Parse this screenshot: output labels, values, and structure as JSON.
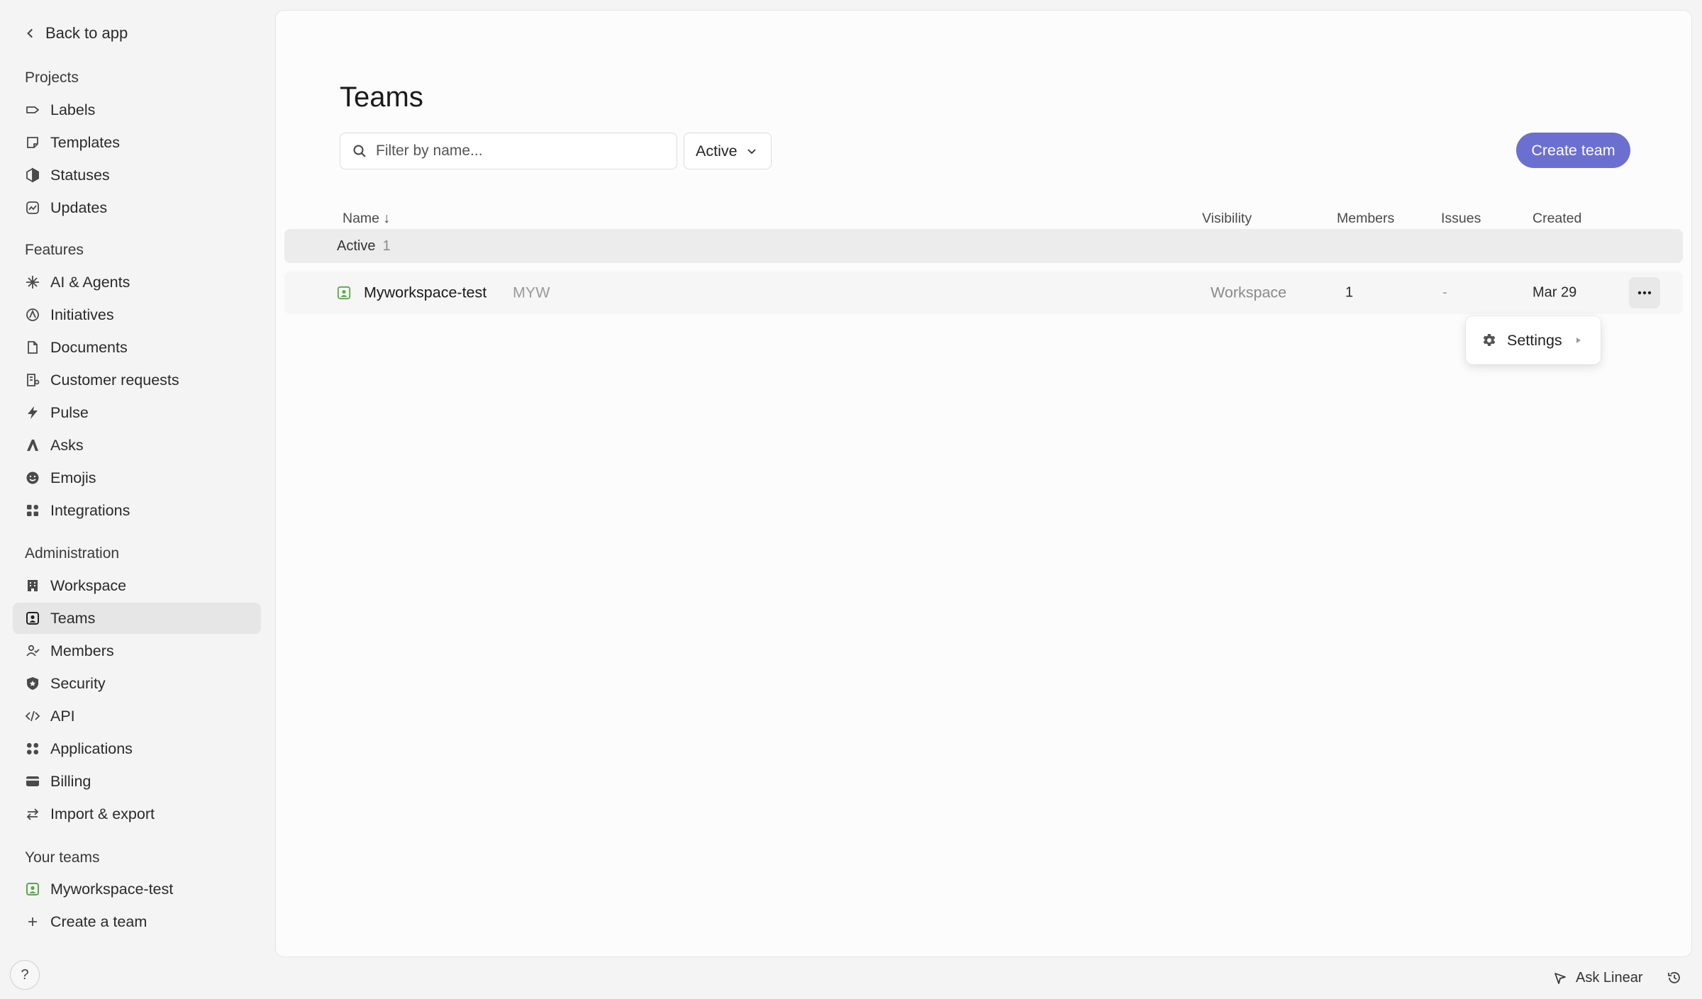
{
  "sidebar": {
    "back_label": "Back to app",
    "sections": {
      "projects": "Projects",
      "features": "Features",
      "administration": "Administration",
      "your_teams": "Your teams"
    },
    "items": {
      "labels": "Labels",
      "templates": "Templates",
      "statuses": "Statuses",
      "updates": "Updates",
      "ai_agents": "AI & Agents",
      "initiatives": "Initiatives",
      "documents": "Documents",
      "customer_requests": "Customer requests",
      "pulse": "Pulse",
      "asks": "Asks",
      "emojis": "Emojis",
      "integrations": "Integrations",
      "workspace": "Workspace",
      "teams": "Teams",
      "members": "Members",
      "security": "Security",
      "api": "API",
      "applications": "Applications",
      "billing": "Billing",
      "import_export": "Import & export",
      "my_team": "Myworkspace-test",
      "create_team": "Create a team"
    },
    "help_label": "?"
  },
  "main": {
    "title": "Teams",
    "search_placeholder": "Filter by name...",
    "status_filter": "Active",
    "create_button": "Create team",
    "columns": {
      "name": "Name ↓",
      "visibility": "Visibility",
      "members": "Members",
      "issues": "Issues",
      "created": "Created"
    },
    "group": {
      "label": "Active",
      "count": "1"
    },
    "rows": [
      {
        "name": "Myworkspace-test",
        "key": "MYW",
        "visibility": "Workspace",
        "members": "1",
        "issues": "-",
        "created": "Mar 29"
      }
    ],
    "menu": {
      "settings": "Settings"
    }
  },
  "footer": {
    "ask_label": "Ask Linear"
  },
  "colors": {
    "accent": "#6b6fcf",
    "team_icon": "#5aa84a"
  }
}
